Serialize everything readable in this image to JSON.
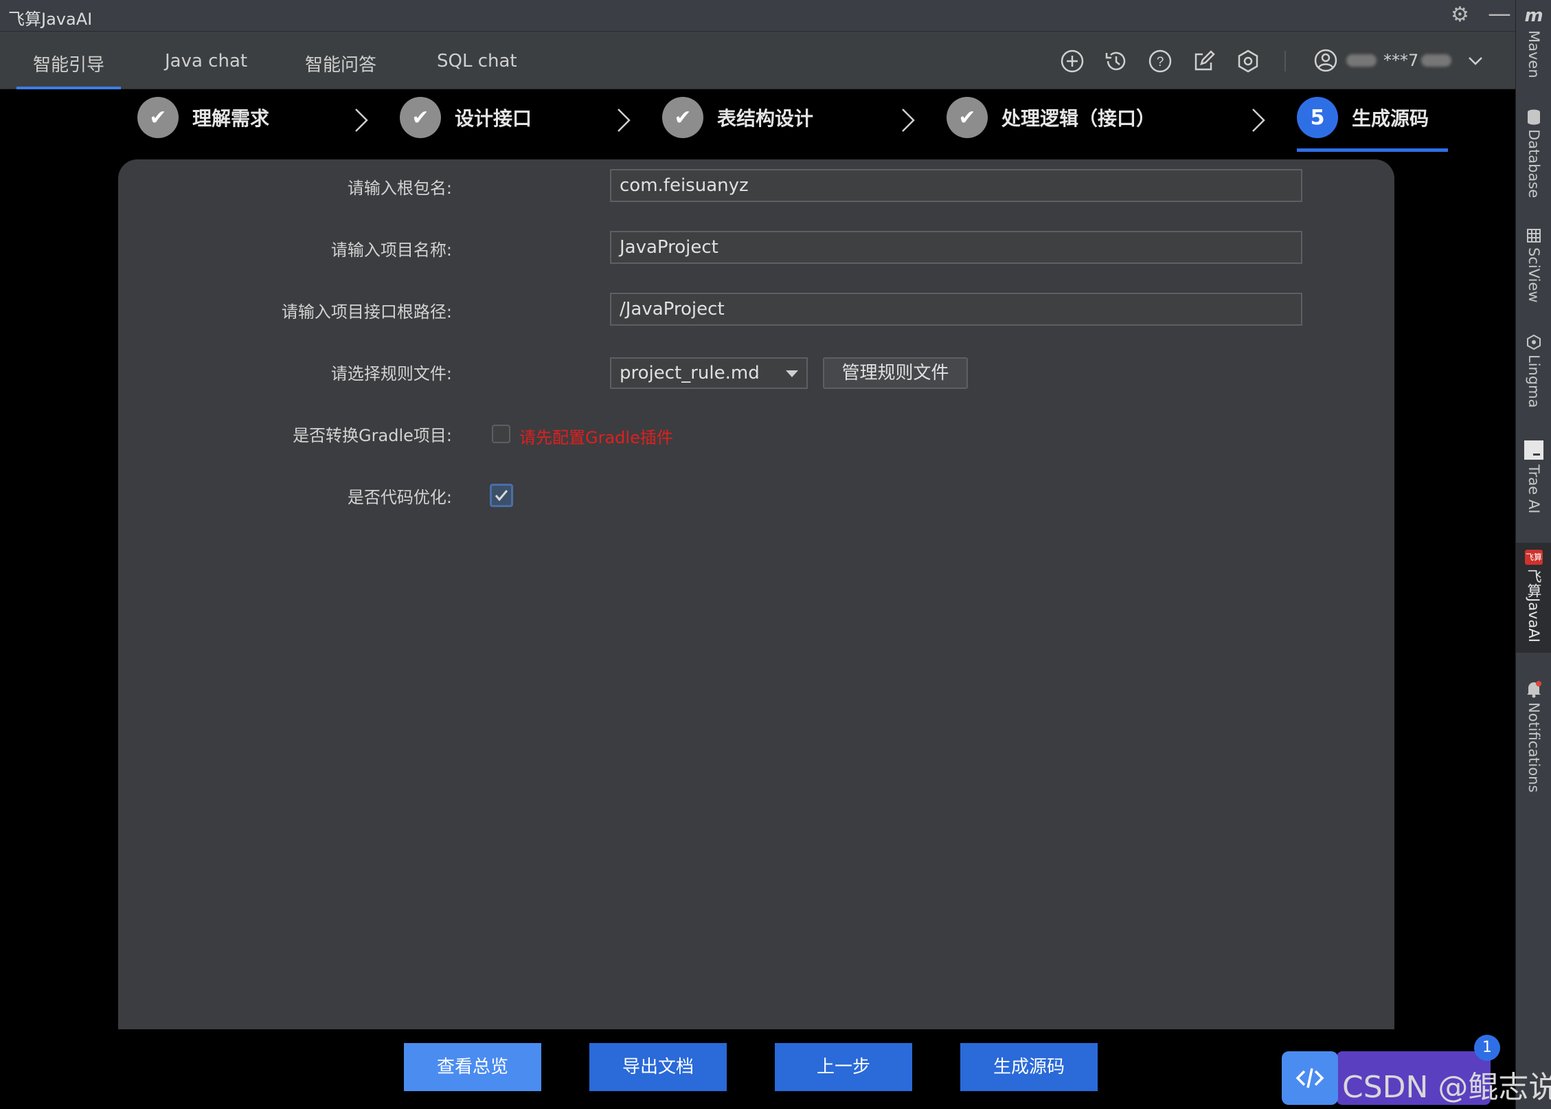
{
  "app": {
    "title": "飞算JavaAI"
  },
  "nav": {
    "tabs": [
      "智能引导",
      "Java chat",
      "智能问答",
      "SQL chat"
    ],
    "user_masked": "***7"
  },
  "steps": [
    {
      "label": "理解需求",
      "status": "done"
    },
    {
      "label": "设计接口",
      "status": "done"
    },
    {
      "label": "表结构设计",
      "status": "done"
    },
    {
      "label": "处理逻辑（接口）",
      "status": "done"
    },
    {
      "label": "生成源码",
      "status": "active",
      "number": "5"
    }
  ],
  "form": {
    "package_label": "请输入根包名:",
    "package_value": "com.feisuanyz",
    "project_label": "请输入项目名称:",
    "project_value": "JavaProject",
    "path_label": "请输入项目接口根路径:",
    "path_value": "/JavaProject",
    "rule_label": "请选择规则文件:",
    "rule_value": "project_rule.md",
    "manage_label": "管理规则文件",
    "gradle_label": "是否转换Gradle项目:",
    "gradle_checked": false,
    "gradle_warning": "请先配置Gradle插件",
    "optimize_label": "是否代码优化:",
    "optimize_checked": true
  },
  "buttons": {
    "overview": "查看总览",
    "export": "导出文档",
    "prev": "上一步",
    "generate": "生成源码"
  },
  "sidebar": {
    "logo": "m",
    "items": [
      "Maven",
      "Database",
      "SciView",
      "Lingma",
      "Trae AI",
      "飞算JavaAI",
      "Notifications"
    ]
  },
  "widget": {
    "badge": "1",
    "watermark": "CSDN @鲲志说"
  },
  "colors": {
    "accent": "#2f6fe6",
    "warning": "#e01f1f",
    "panel": "#3c3d40"
  }
}
